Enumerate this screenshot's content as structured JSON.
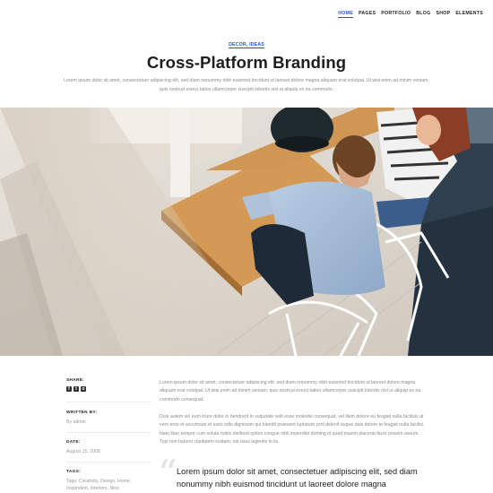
{
  "nav": {
    "items": [
      "HOME",
      "PAGES",
      "PORTFOLIO",
      "BLOG",
      "SHOP",
      "ELEMENTS"
    ],
    "active": "HOME",
    "accent_color": "#2a4fd6"
  },
  "post": {
    "category": "DECOR, IDEAS",
    "title": "Cross-Platform Branding",
    "intro": "Lorem ipsum dolor sit amet, consectetuer adipiscing elit, sed diam nonummy nibh euismod tincidunt ut laoreet dolore magna aliquam erat volutpat. Ut wisi enim ad minim veniam, quis nostrud exerci tation ullamcorper suscipit lobortis nisl ut aliquip ex ea commodo."
  },
  "meta": {
    "share_label": "SHARE:",
    "share_icons": [
      "facebook-icon",
      "twitter-icon",
      "instagram-icon"
    ],
    "written_label": "WRITTEN BY:",
    "author": "By admin",
    "date_label": "DATE:",
    "date": "August 15, 2008",
    "tags_label": "TAGS:",
    "tags": "Tags: Creativity, Design, Home, Inspiration, Interiors, New"
  },
  "content": {
    "paragraph_1": "Lorem ipsum dolor sit amet, consectetuer adipiscing elit, sed diam nonummy nibh euismod tincidunt ut laoreet dolore magna aliquam erat volutpat. Ut wisi enim ad minim veniam, quis nostrud exerci tation ullamcorper suscipit lobortis nisl ut aliquip ex ea commodo consequat.",
    "paragraph_2": "Duis autem vel eum iriure dolor in hendrerit in vulputate velit esse molestie consequat, vel illum dolore eu feugiat nulla facilisis at vero eros et accumsan et iusto odio dignissim qui blandit praesent luptatum zzril delenit augue duis dolore te feugait nulla facilisi. Nam liber tempor cum soluta nobis eleifend option congue nihil imperdiet doming id quod mazim placerat facer possim assum. Typi non habent claritatem insitam; est usus legentis in iis.",
    "quote": "Lorem ipsum dolor sit amet, consectetuer adipiscing elit, sed diam nonummy nibh euismod tincidunt ut laoreet dolore magna"
  }
}
